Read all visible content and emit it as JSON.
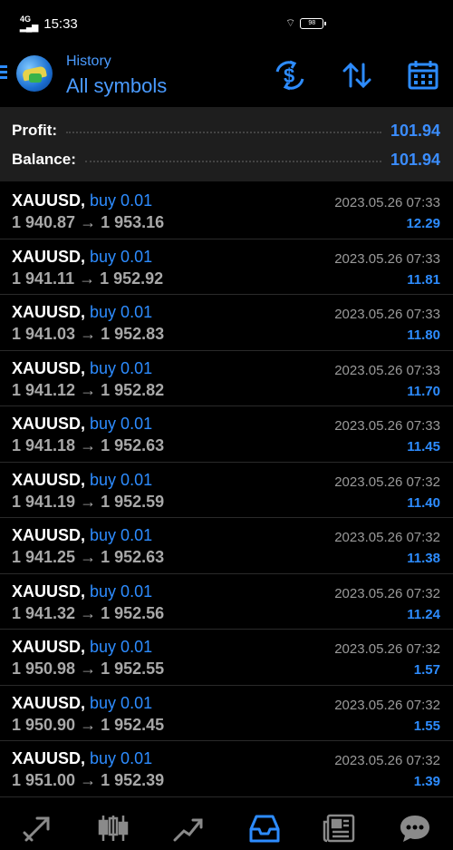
{
  "status_bar": {
    "network": "4G",
    "time": "15:33",
    "battery": "98"
  },
  "header": {
    "subtitle": "History",
    "title": "All symbols"
  },
  "summary": {
    "profit_label": "Profit:",
    "profit_value": "101.94",
    "balance_label": "Balance:",
    "balance_value": "101.94"
  },
  "deals": [
    {
      "symbol": "XAUUSD,",
      "type": "buy 0.01",
      "open": "1 940.87",
      "arrow": "→",
      "close": "1 953.16",
      "time": "2023.05.26 07:33",
      "profit": "12.29"
    },
    {
      "symbol": "XAUUSD,",
      "type": "buy 0.01",
      "open": "1 941.11",
      "arrow": "→",
      "close": "1 952.92",
      "time": "2023.05.26 07:33",
      "profit": "11.81"
    },
    {
      "symbol": "XAUUSD,",
      "type": "buy 0.01",
      "open": "1 941.03",
      "arrow": "→",
      "close": "1 952.83",
      "time": "2023.05.26 07:33",
      "profit": "11.80"
    },
    {
      "symbol": "XAUUSD,",
      "type": "buy 0.01",
      "open": "1 941.12",
      "arrow": "→",
      "close": "1 952.82",
      "time": "2023.05.26 07:33",
      "profit": "11.70"
    },
    {
      "symbol": "XAUUSD,",
      "type": "buy 0.01",
      "open": "1 941.18",
      "arrow": "→",
      "close": "1 952.63",
      "time": "2023.05.26 07:33",
      "profit": "11.45"
    },
    {
      "symbol": "XAUUSD,",
      "type": "buy 0.01",
      "open": "1 941.19",
      "arrow": "→",
      "close": "1 952.59",
      "time": "2023.05.26 07:32",
      "profit": "11.40"
    },
    {
      "symbol": "XAUUSD,",
      "type": "buy 0.01",
      "open": "1 941.25",
      "arrow": "→",
      "close": "1 952.63",
      "time": "2023.05.26 07:32",
      "profit": "11.38"
    },
    {
      "symbol": "XAUUSD,",
      "type": "buy 0.01",
      "open": "1 941.32",
      "arrow": "→",
      "close": "1 952.56",
      "time": "2023.05.26 07:32",
      "profit": "11.24"
    },
    {
      "symbol": "XAUUSD,",
      "type": "buy 0.01",
      "open": "1 950.98",
      "arrow": "→",
      "close": "1 952.55",
      "time": "2023.05.26 07:32",
      "profit": "1.57"
    },
    {
      "symbol": "XAUUSD,",
      "type": "buy 0.01",
      "open": "1 950.90",
      "arrow": "→",
      "close": "1 952.45",
      "time": "2023.05.26 07:32",
      "profit": "1.55"
    },
    {
      "symbol": "XAUUSD,",
      "type": "buy 0.01",
      "open": "1 951.00",
      "arrow": "→",
      "close": "1 952.39",
      "time": "2023.05.26 07:32",
      "profit": "1.39"
    }
  ],
  "icons": {
    "header": [
      "menu-icon",
      "metatrader-logo-icon",
      "currency-exchange-icon",
      "sort-icon",
      "calendar-icon"
    ],
    "bottom_nav": [
      "quotes-icon",
      "chart-icon",
      "trade-icon",
      "history-icon",
      "news-icon",
      "messages-icon"
    ]
  },
  "colors": {
    "accent": "#2d8cff",
    "background": "#000000",
    "summary_background": "#1e1e1e",
    "price_text": "#a8a8a8",
    "time_text": "#9a9a9a"
  }
}
